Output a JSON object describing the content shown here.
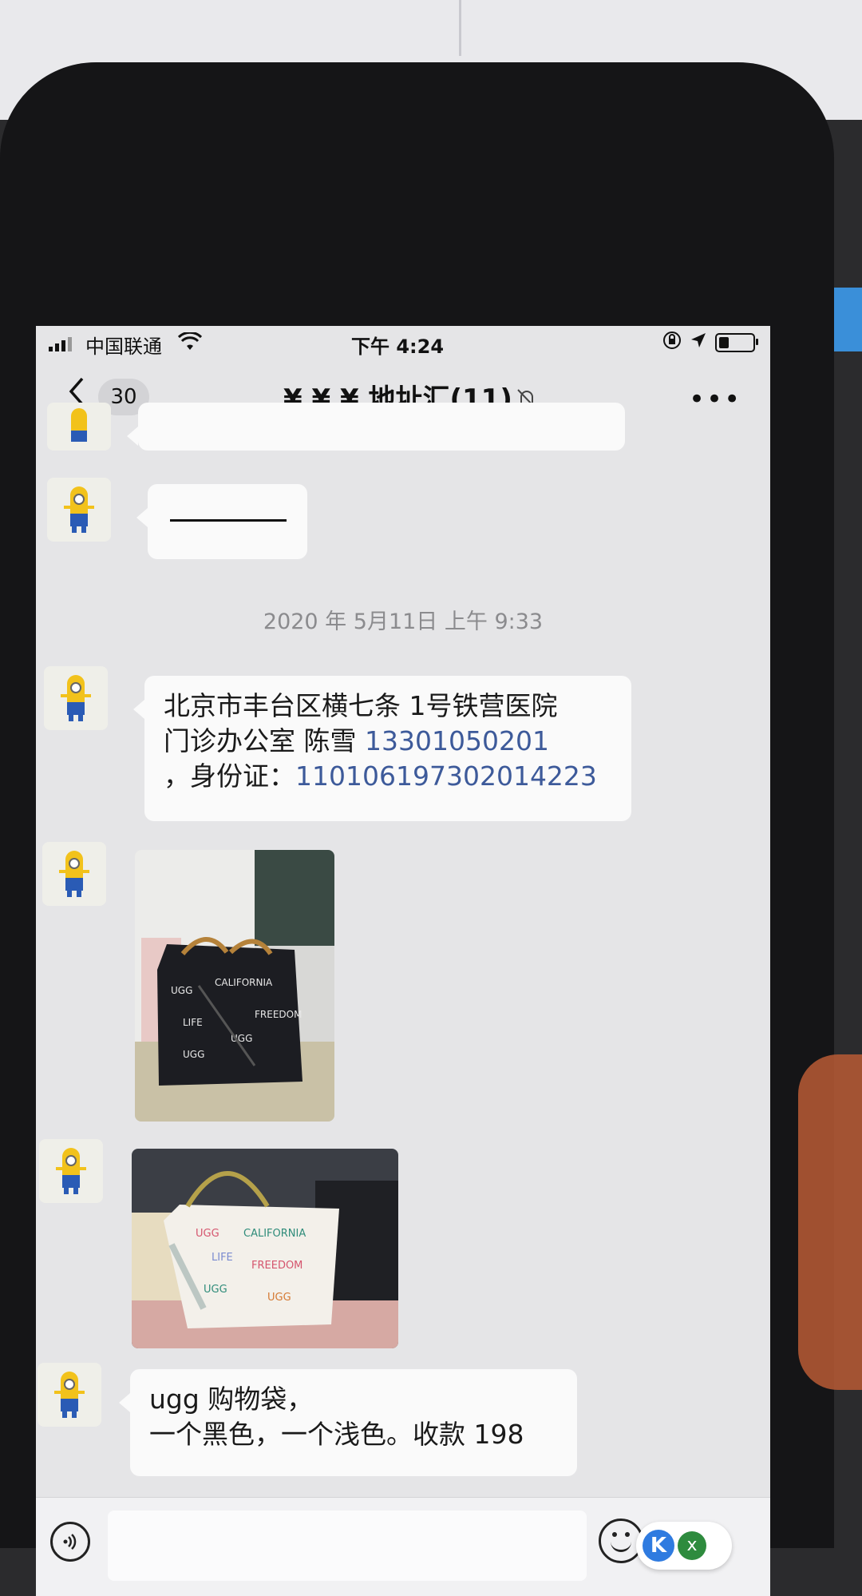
{
  "status_bar": {
    "carrier": "中国联通",
    "time": "下午 4:24",
    "battery_level": 0.3
  },
  "nav": {
    "back_count": "30",
    "title": "¥ ¥ ¥ 地址汇(11)"
  },
  "chat": {
    "timestamp": "2020 年 5月11日 上午 9:33",
    "messages": [
      {
        "type": "text",
        "line1": "北京市丰台区横七条 1号铁营医院",
        "line2_text": "门诊办公室  陈雪  ",
        "line2_phone": "13301050201",
        "line3_text": "，身份证：",
        "line3_id": "110106197302014223"
      },
      {
        "type": "image",
        "description": "black-bag-photo"
      },
      {
        "type": "image",
        "description": "light-bag-photo"
      },
      {
        "type": "text",
        "line1": "ugg 购物袋，",
        "line2": "一个黑色，一个浅色。收款 198"
      }
    ]
  },
  "input_bar": {
    "float_badge_k": "K",
    "float_badge_x": "x"
  },
  "colors": {
    "chat_background": "#e5e5e7",
    "bubble": "#fafafa",
    "link": "#3d5a9a"
  }
}
